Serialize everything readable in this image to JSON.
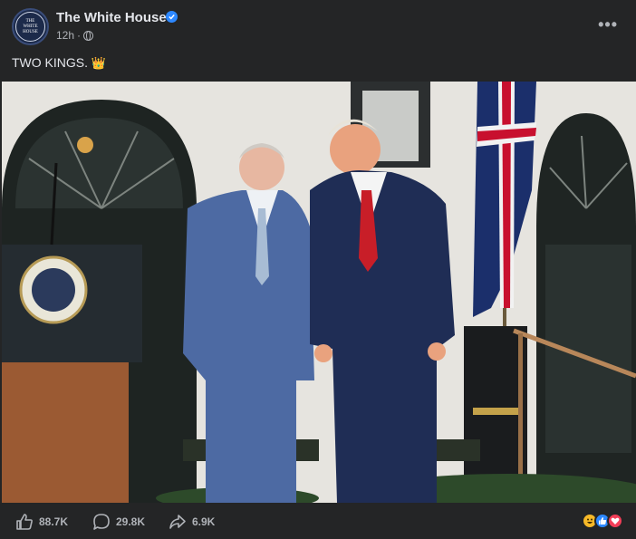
{
  "post": {
    "page_name": "The White House",
    "avatar_lines": [
      "THE",
      "WHITE",
      "HOUSE"
    ],
    "time": "12h",
    "separator": "·",
    "text": "TWO KINGS.",
    "crown_emoji": "👑"
  },
  "photo": {
    "icon": "photo-two-men-portico"
  },
  "stats": {
    "likes": "88.7K",
    "comments": "29.8K",
    "shares": "6.9K"
  },
  "colors": {
    "background": "#242526",
    "text": "#e4e6eb",
    "secondary_text": "#b0b3b8",
    "verified_blue": "#2d88ff"
  }
}
